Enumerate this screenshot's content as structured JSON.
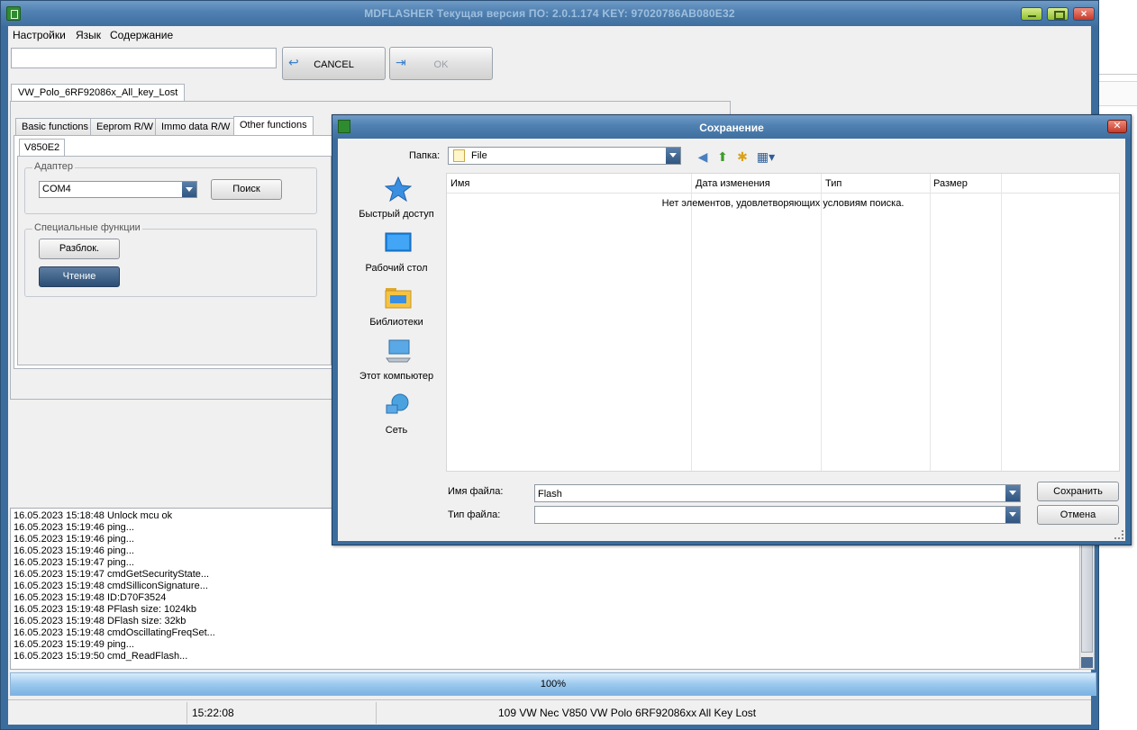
{
  "window": {
    "title": "MDFLASHER  Текущая версия ПО: 2.0.1.174  KEY: 97020786AB080E32"
  },
  "menu": [
    "Настройки",
    "Язык",
    "Содержание"
  ],
  "toolbar": {
    "cancel_label": "CANCEL",
    "ok_label": "OK"
  },
  "doc_tab": "VW_Polo_6RF92086x_All_key_Lost",
  "tabs": [
    "Basic functions",
    "Eeprom R/W",
    "Immo data R/W",
    "Other functions"
  ],
  "subtab": "V850E2",
  "adapter": {
    "group_label": "Адаптер",
    "port_value": "COM4",
    "search_label": "Поиск"
  },
  "special": {
    "group_label": "Специальные функции",
    "unlock_label": "Разблок.",
    "read_label": "Чтение"
  },
  "log": [
    "16.05.2023 15:18:48  Unlock mcu ok",
    "16.05.2023 15:19:46  ping...",
    "16.05.2023 15:19:46  ping...",
    "16.05.2023 15:19:46  ping...",
    "16.05.2023 15:19:47  ping...",
    "16.05.2023 15:19:47  cmdGetSecurityState...",
    "16.05.2023 15:19:48  cmdSilliconSignature...",
    "16.05.2023 15:19:48  ID:D70F3524",
    "16.05.2023 15:19:48  PFlash size: 1024kb",
    "16.05.2023 15:19:48  DFlash size: 32kb",
    "16.05.2023 15:19:48  cmdOscillatingFreqSet...",
    "16.05.2023 15:19:49  ping...",
    "16.05.2023 15:19:50  cmd_ReadFlash..."
  ],
  "progress": {
    "label": "100%",
    "value": 1.0
  },
  "status": {
    "time": "15:22:08",
    "info": "109 VW Nec V850 VW Polo 6RF92086xx All Key Lost"
  },
  "dialog": {
    "title": "Сохранение",
    "folder_label": "Папка:",
    "folder_value": "File",
    "places": [
      "Быстрый доступ",
      "Рабочий стол",
      "Библиотеки",
      "Этот компьютер",
      "Сеть"
    ],
    "columns": [
      "Имя",
      "Дата изменения",
      "Тип",
      "Размер"
    ],
    "empty_message": "Нет элементов, удовлетворяющих условиям поиска.",
    "filename_label": "Имя файла:",
    "filename_value": "Flash",
    "filetype_label": "Тип файла:",
    "filetype_value": "",
    "save_label": "Сохранить",
    "cancel_label": "Отмена"
  },
  "colors": {
    "title_bar": "#4f80b1",
    "progress_fill": "#9cc9ee",
    "dark_button": "#2b4e75"
  }
}
